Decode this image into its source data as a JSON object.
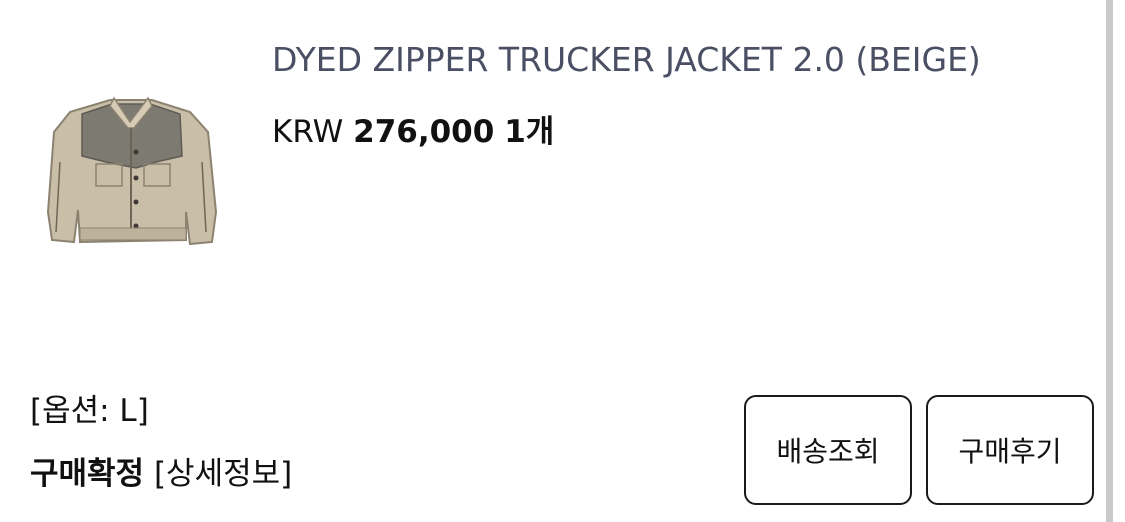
{
  "product": {
    "name": "DYED ZIPPER TRUCKER JACKET 2.0 (BEIGE)",
    "currency": "KRW",
    "price": "276,000",
    "quantity": "1개",
    "image_alt": "beige trucker jacket thumbnail"
  },
  "order": {
    "option": "[옵션: L]",
    "status": "구매확정",
    "detail_link": "[상세정보]"
  },
  "actions": {
    "track_label": "배송조회",
    "review_label": "구매후기"
  },
  "colors": {
    "product_name": "#4a4f63",
    "text": "#111111",
    "button_border": "#1a1a1a",
    "scrollbar": "#c9c9c9"
  }
}
